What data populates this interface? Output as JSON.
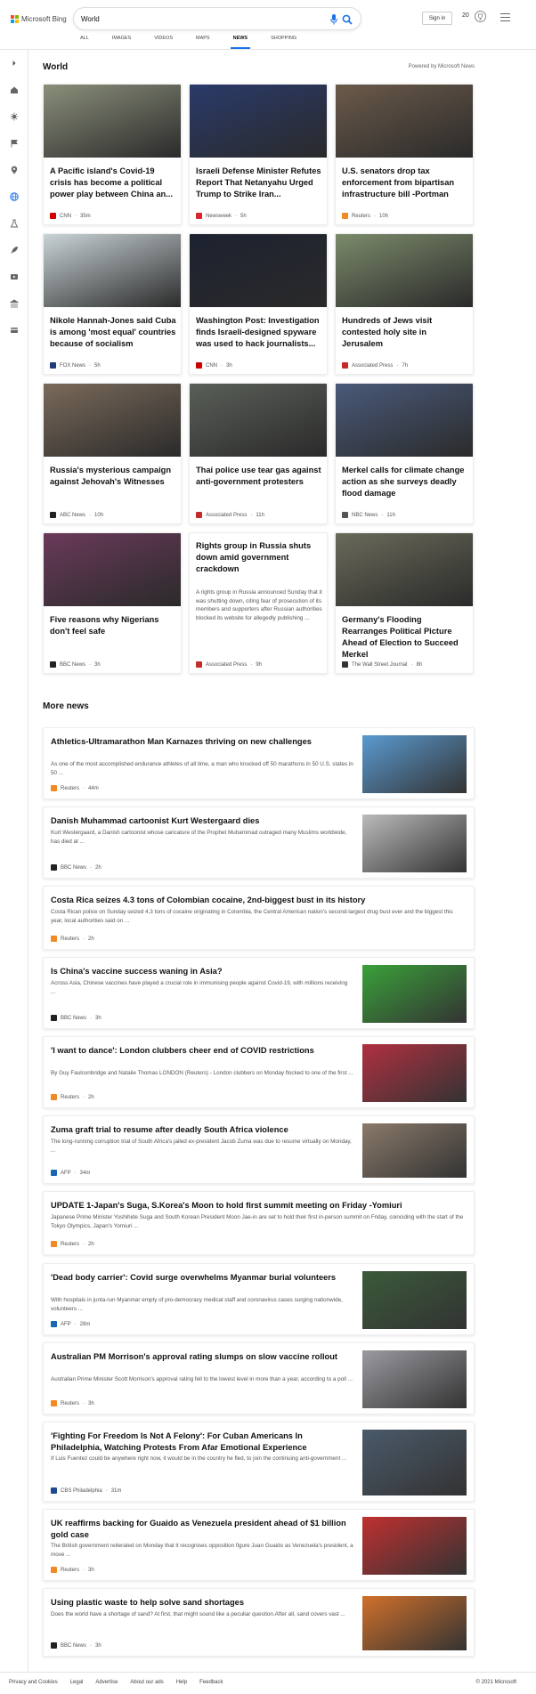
{
  "brand": "Microsoft Bing",
  "search": {
    "query": "World"
  },
  "header": {
    "signin": "Sign in",
    "points": "20"
  },
  "tabs": [
    {
      "label": "ALL"
    },
    {
      "label": "IMAGES"
    },
    {
      "label": "VIDEOS"
    },
    {
      "label": "MAPS"
    },
    {
      "label": "NEWS"
    },
    {
      "label": "SHOPPING"
    }
  ],
  "section": {
    "title": "World",
    "powered": "Powered by Microsoft News"
  },
  "cards": [
    {
      "title": "A Pacific island's Covid-19 crisis has become a political power play between China an...",
      "source": "CNN",
      "time": "35m",
      "color": "#8a8f7a"
    },
    {
      "title": "Israeli Defense Minister Refutes Report That Netanyahu Urged Trump to Strike Iran...",
      "source": "Newsweek",
      "time": "5h",
      "color": "#2a3a6a"
    },
    {
      "title": "U.S. senators drop tax enforcement from bipartisan infrastructure bill -Portman",
      "source": "Reuters",
      "time": "10h",
      "color": "#6b5a4a"
    },
    {
      "title": "Nikole Hannah-Jones said Cuba is among 'most equal' countries because of socialism",
      "source": "FOX News",
      "time": "5h",
      "color": "#c9d3d6"
    },
    {
      "title": "Washington Post: Investigation finds Israeli-designed spyware was used to hack journalists...",
      "source": "CNN",
      "time": "3h",
      "color": "#1d2230"
    },
    {
      "title": "Hundreds of Jews visit contested holy site in Jerusalem",
      "source": "Associated Press",
      "time": "7h",
      "color": "#7b8a6a"
    },
    {
      "title": "Russia's mysterious campaign against Jehovah's Witnesses",
      "source": "ABC News",
      "time": "10h",
      "color": "#7a6a5a"
    },
    {
      "title": "Thai police use tear gas against anti-government protesters",
      "source": "Associated Press",
      "time": "11h",
      "color": "#5a5f58"
    },
    {
      "title": "Merkel calls for climate change action as she surveys deadly flood damage",
      "source": "NBC News",
      "time": "11h",
      "color": "#4a5a7a"
    },
    {
      "title": "Five reasons why Nigerians don't feel safe",
      "source": "BBC News",
      "time": "3h",
      "color": "#6a3a5a"
    },
    {
      "title": "Rights group in Russia shuts down amid government crackdown",
      "desc": "A rights group in Russia announced Sunday that it was shutting down, citing fear of prosecution of its members and supporters after Russian authorities blocked its website for allegedly publishing ...",
      "source": "Associated Press",
      "time": "9h"
    },
    {
      "title": "Germany's Flooding Rearranges Political Picture Ahead of Election to Succeed Merkel",
      "source": "The Wall Street Journal",
      "time": "8h",
      "color": "#6a6a5a"
    }
  ],
  "more": {
    "title": "More news",
    "items": [
      {
        "title": "Athletics-Ultramarathon Man Karnazes thriving on new challenges",
        "desc": "As one of the most accomplished endurance athletes of all time, a man who knocked off 50 marathons in 50 U.S. states in 50 ...",
        "source": "Reuters",
        "time": "44m",
        "color": "#5a9ad0"
      },
      {
        "title": "Danish Muhammad cartoonist Kurt Westergaard dies",
        "desc": "Kurt Westergaard, a Danish cartoonist whose caricature of the Prophet Muhammad outraged many Muslims worldwide, has died at ...",
        "source": "BBC News",
        "time": "2h",
        "color": "#bbbbbb"
      },
      {
        "title": "Costa Rica seizes 4.3 tons of Colombian cocaine, 2nd-biggest bust in its history",
        "desc": "Costa Rican police on Sunday seized 4.3 tons of cocaine originating in Colombia, the Central American nation's second-largest drug bust ever and the biggest this year, local authorities said on ...",
        "source": "Reuters",
        "time": "2h"
      },
      {
        "title": "Is China's vaccine success waning in Asia?",
        "desc": "Across Asia, Chinese vaccines have played a crucial role in immunising people against Covid-19, with millions receiving ...",
        "source": "BBC News",
        "time": "3h",
        "color": "#3aa03a"
      },
      {
        "title": "'I want to dance': London clubbers cheer end of COVID restrictions",
        "desc": "By Guy Faulconbridge and Natalie Thomas LONDON (Reuters) - London clubbers on Monday flocked to one of the first ...",
        "source": "Reuters",
        "time": "2h",
        "color": "#b03040"
      },
      {
        "title": "Zuma graft trial to resume after deadly South Africa violence",
        "desc": "The long-running corruption trial of South Africa's jailed ex-president Jacob Zuma was due to resume virtually on Monday, ...",
        "source": "AFP",
        "time": "34m",
        "color": "#8a7a6a"
      },
      {
        "title": "UPDATE 1-Japan's Suga, S.Korea's Moon to hold first summit meeting on Friday -Yomiuri",
        "desc": "Japanese Prime Minister Yoshihide Suga and South Korean President Moon Jae-in are set to hold their first in-person summit on Friday, coinciding with the start of the Tokyo Olympics, Japan's Yomiuri ...",
        "source": "Reuters",
        "time": "2h"
      },
      {
        "title": "'Dead body carrier': Covid surge overwhelms Myanmar burial volunteers",
        "desc": "With hospitals in junta-run Myanmar empty of pro-democracy medical staff and coronavirus cases surging nationwide, volunteers ...",
        "source": "AFP",
        "time": "28m",
        "color": "#3a5a3a"
      },
      {
        "title": "Australian PM Morrison's approval rating slumps on slow vaccine rollout",
        "desc": "Australian Prime Minister Scott Morrison's approval rating fell to the lowest level in more than a year, according to a poll ...",
        "source": "Reuters",
        "time": "3h",
        "color": "#9a9aa0"
      },
      {
        "title": "'Fighting For Freedom Is Not A Felony': For Cuban Americans In Philadelphia, Watching Protests From Afar Emotional Experience",
        "desc": "If Luis Fuentez could be anywhere right now, it would be in the country he fled, to join the continuing anti-government ...",
        "source": "CBS Philadelphia",
        "time": "31m",
        "color": "#4a5a6a"
      },
      {
        "title": "UK reaffirms backing for Guaido as Venezuela president ahead of $1 billion gold case",
        "desc": "The British government reiterated on Monday that it recognises opposition figure Juan Guaido as Venezuela's president, a move ...",
        "source": "Reuters",
        "time": "3h",
        "color": "#c03030"
      },
      {
        "title": "Using plastic waste to help solve sand shortages",
        "desc": "Does the world have a shortage of sand? At first, that might sound like a peculiar question.After all, sand covers vast ...",
        "source": "BBC News",
        "time": "3h",
        "color": "#d0702a"
      }
    ]
  },
  "footer": {
    "links": [
      "Privacy and Cookies",
      "Legal",
      "Advertise",
      "About our ads",
      "Help",
      "Feedback"
    ],
    "copyright": "© 2021 Microsoft"
  },
  "sources": {
    "CNN": "#cc0000",
    "Newsweek": "#d8252b",
    "Reuters": "#f08a24",
    "FOX News": "#1f3c7a",
    "Associated Press": "#c42b2b",
    "ABC News": "#222222",
    "NBC News": "#555555",
    "BBC News": "#222222",
    "The Wall Street Journal": "#333333",
    "AFP": "#1a66b3",
    "CBS Philadelphia": "#1c4a8a"
  }
}
